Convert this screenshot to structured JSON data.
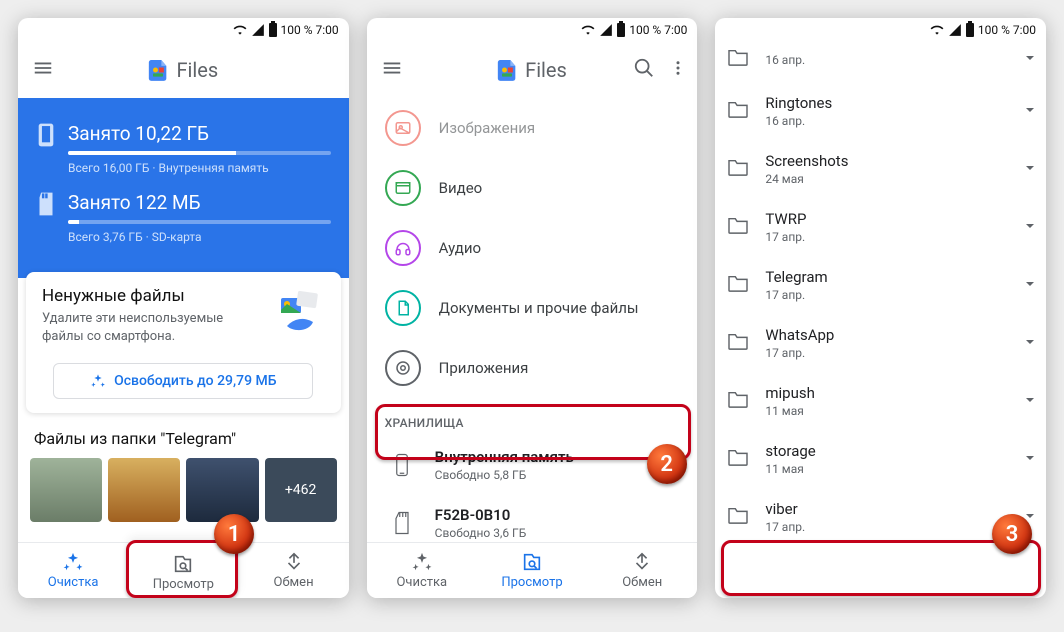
{
  "status": {
    "pct": "100 % 7:00"
  },
  "app": {
    "title": "Files"
  },
  "s1": {
    "internal": {
      "title": "Занято 10,22 ГБ",
      "sub": "Всего 16,00 ГБ · Внутренняя память",
      "pct": 64
    },
    "sd": {
      "title": "Занято 122 МБ",
      "sub": "Всего 3,76 ГБ · SD-карта",
      "pct": 4
    },
    "junk": {
      "title": "Ненужные файлы",
      "sub": "Удалите эти неиспользуемые файлы со смартфона."
    },
    "free_btn": "Освободить до 29,79 МБ",
    "album": {
      "title": "Файлы из папки \"Telegram\"",
      "more": "+462"
    },
    "nav": {
      "clean": "Очистка",
      "browse": "Просмотр",
      "share": "Обмен"
    }
  },
  "s2": {
    "cats": {
      "images": "Изображения",
      "video": "Видео",
      "audio": "Аудио",
      "docs": "Документы и прочие файлы",
      "apps": "Приложения"
    },
    "stores_head": "ХРАНИЛИЩА",
    "internal": {
      "title": "Внутренняя память",
      "sub": "Свободно 5,8 ГБ"
    },
    "sd": {
      "title": "F52B-0B10",
      "sub": "Свободно 3,6 ГБ"
    }
  },
  "s3": {
    "folders": [
      {
        "name": "",
        "date": "16 апр."
      },
      {
        "name": "Ringtones",
        "date": "16 апр."
      },
      {
        "name": "Screenshots",
        "date": "24 мая"
      },
      {
        "name": "TWRP",
        "date": "17 апр."
      },
      {
        "name": "Telegram",
        "date": "17 апр."
      },
      {
        "name": "WhatsApp",
        "date": "17 апр."
      },
      {
        "name": "mipush",
        "date": "11 мая"
      },
      {
        "name": "storage",
        "date": "11 мая"
      },
      {
        "name": "viber",
        "date": "17 апр."
      }
    ]
  },
  "badges": {
    "b1": "1",
    "b2": "2",
    "b3": "3"
  }
}
